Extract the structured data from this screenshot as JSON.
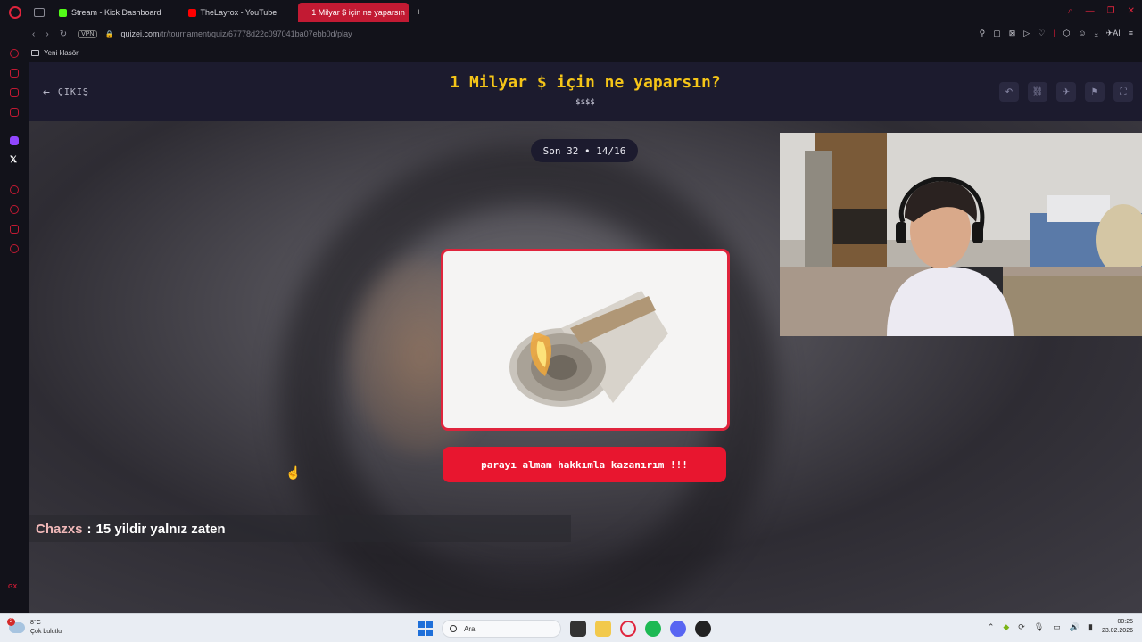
{
  "browser": {
    "tabs": [
      {
        "label": "Stream - Kick Dashboard",
        "favicon_color": "#53fc18"
      },
      {
        "label": "TheLayrox - YouTube",
        "favicon_color": "#ff0000"
      },
      {
        "label": "1 Milyar $ için ne yaparsın",
        "favicon_color": "#f5c518",
        "active": true
      }
    ],
    "vpn_label": "VPN",
    "url_host": "quizei.com",
    "url_path": "/tr/tournament/quiz/67778d22c097041ba07ebb0d/play",
    "ai_label": "AI",
    "bookmark_folder": "Yeni klasör",
    "sidebar_label": "GX"
  },
  "quiz": {
    "back_label": "ÇIKIŞ",
    "title": "1 Milyar $ için ne yaparsın?",
    "subtitle": "$$$$",
    "progress": "Son 32 • 14/16",
    "answer": "parayı almam hakkımla kazanırım !!!"
  },
  "chat": {
    "user": "Chazxs",
    "separator": ":",
    "message": "15 yildir yalnız zaten"
  },
  "taskbar": {
    "weather_badge": "2",
    "temperature": "8°C",
    "condition": "Çok bulutlu",
    "search_placeholder": "Ara",
    "time": "00:25",
    "date": "23.02.2026"
  },
  "colors": {
    "accent": "#e8162f",
    "title_yellow": "#f5c518",
    "header_bg": "#1c1b2e"
  }
}
